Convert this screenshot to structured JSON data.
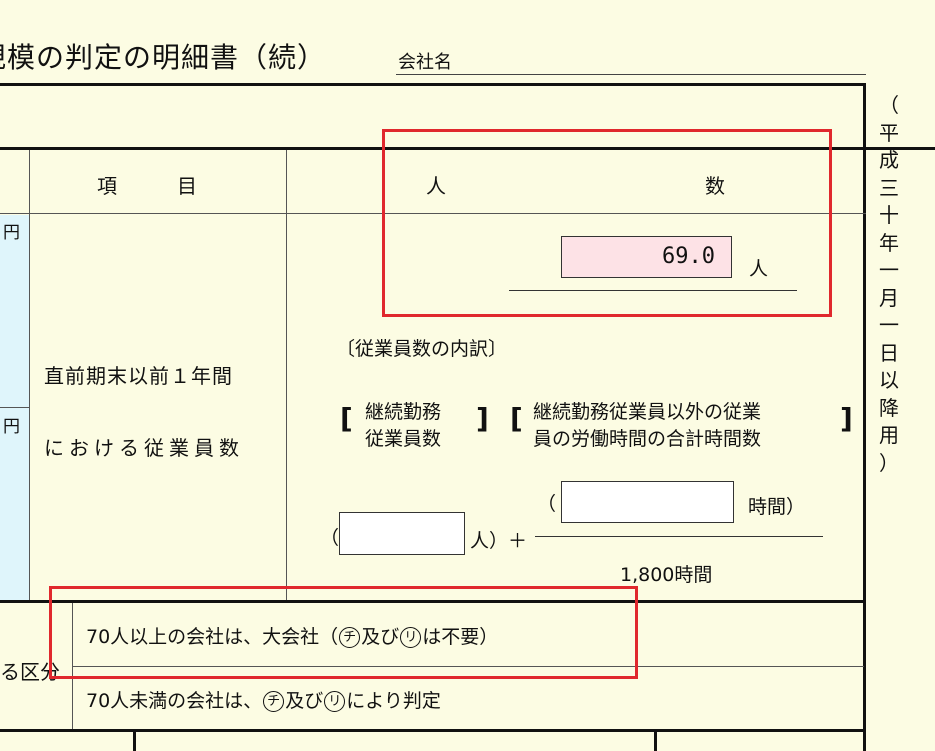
{
  "header": {
    "title": "規模の判定の明細書（続）",
    "company_label": "会社名"
  },
  "side_note": [
    "（",
    "平",
    "成",
    "三",
    "十",
    "年",
    "一",
    "月",
    "一",
    "日",
    "以",
    "降",
    "用",
    "）"
  ],
  "table": {
    "col_item": "項　　　目",
    "col_people_1": "人",
    "col_people_2": "数",
    "yen_1": "円",
    "yen_2": "円",
    "row_label_1": "直前期末以前１年間",
    "row_label_2": "における従業員数",
    "employee_count": "69.0",
    "person_unit": "人",
    "breakdown_label": "〔従業員数の内訳〕",
    "continuous_1": "継続勤務",
    "continuous_2": "従業員数",
    "other_1": "継続勤務従業員以外の従業",
    "other_2": "員の労働時間の合計時間数",
    "hours_open": "（",
    "hours_unit": "時間）",
    "count_open": "（",
    "count_unit": "人）＋",
    "denominator": "1,800時間",
    "division_label": "る区分",
    "rule_70_more": {
      "pre": "70人以上の会社は、大会社（",
      "c1": "チ",
      "mid": "及び",
      "c2": "リ",
      "post": "は不要）"
    },
    "rule_70_less": {
      "pre": "70人未満の会社は、",
      "c1": "チ",
      "mid": "及び",
      "c2": "リ",
      "post": "により判定"
    }
  }
}
